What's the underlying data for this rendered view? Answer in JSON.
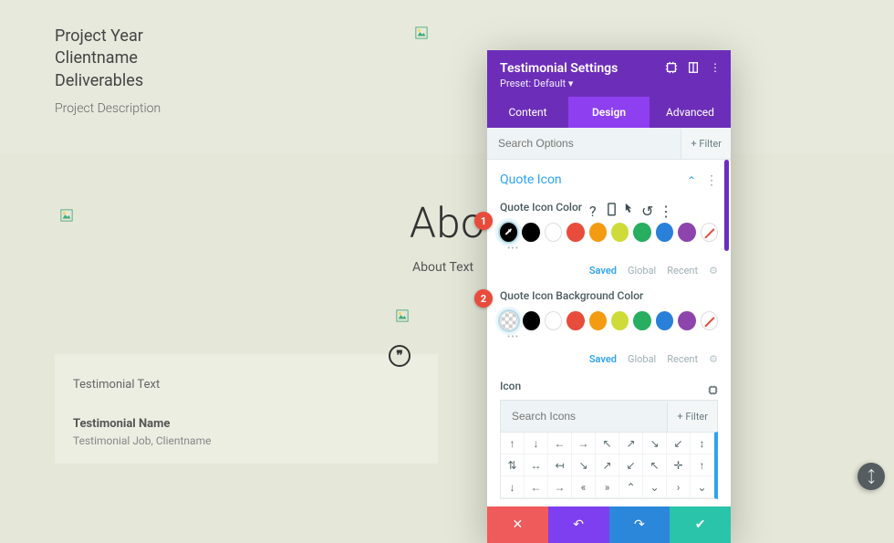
{
  "project": {
    "year": "Project Year",
    "client": "Clientname",
    "deliverables": "Deliverables",
    "description": "Project Description"
  },
  "about": {
    "title": "Abo",
    "text": "About Text"
  },
  "testimonial": {
    "text": "Testimonial Text",
    "name": "Testimonial Name",
    "job": "Testimonial Job, Clientname",
    "quote_glyph": "❞"
  },
  "panel": {
    "title": "Testimonial Settings",
    "preset": "Preset: Default",
    "tabs": {
      "content": "Content",
      "design": "Design",
      "advanced": "Advanced"
    },
    "search_placeholder": "Search Options",
    "filter": "Filter",
    "section": {
      "title": "Quote Icon"
    },
    "field1": {
      "label": "Quote Icon Color"
    },
    "field2": {
      "label": "Quote Icon Background Color"
    },
    "palette_tabs": {
      "saved": "Saved",
      "global": "Global",
      "recent": "Recent"
    },
    "icon": {
      "label": "Icon",
      "search_placeholder": "Search Icons",
      "filter": "Filter"
    },
    "colors": {
      "black": "#000000",
      "white": "#ffffff",
      "red": "#e74c3c",
      "orange": "#f39c12",
      "yellow": "#cddc39",
      "green": "#27ae60",
      "blue": "#2980d9",
      "purple": "#8e44ad"
    }
  },
  "badges": {
    "b1": "1",
    "b2": "2"
  },
  "icon_grid": [
    [
      "↑",
      "↓",
      "←",
      "→",
      "↖",
      "↗",
      "↘",
      "↙",
      "↕"
    ],
    [
      "⇅",
      "↔",
      "↤",
      "↘",
      "↗",
      "↙",
      "↖",
      "✛",
      "↑"
    ],
    [
      "↓",
      "←",
      "→",
      "«",
      "»",
      "⌃",
      "⌄",
      "›",
      "⌄"
    ]
  ]
}
